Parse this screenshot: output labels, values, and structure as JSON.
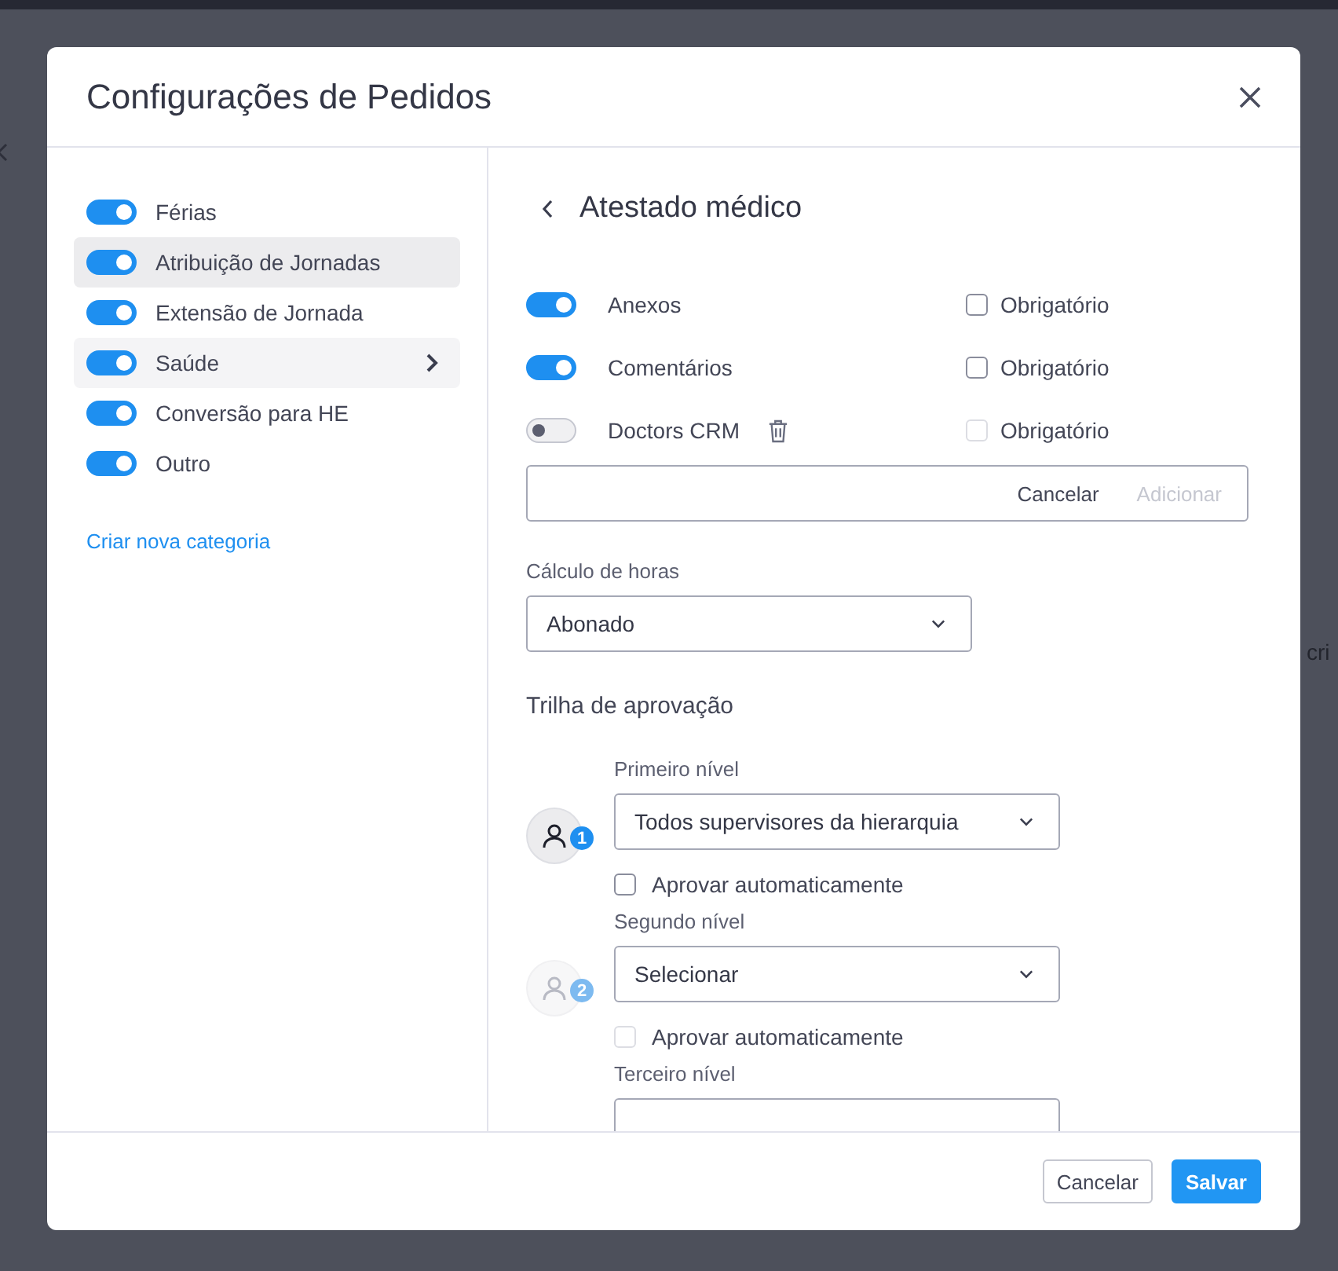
{
  "background": {
    "text": "cri"
  },
  "dialog": {
    "title": "Configurações de Pedidos",
    "categories": [
      {
        "label": "Férias",
        "on": true,
        "selected": false,
        "hovered": false
      },
      {
        "label": "Atribuição de Jornadas",
        "on": true,
        "selected": false,
        "hovered": true
      },
      {
        "label": "Extensão de Jornada",
        "on": true,
        "selected": false,
        "hovered": false
      },
      {
        "label": "Saúde",
        "on": true,
        "selected": true,
        "hovered": false
      },
      {
        "label": "Conversão para HE",
        "on": true,
        "selected": false,
        "hovered": false
      },
      {
        "label": "Outro",
        "on": true,
        "selected": false,
        "hovered": false
      }
    ],
    "new_category_link": "Criar nova categoria",
    "detail": {
      "title": "Atestado médico",
      "fields": [
        {
          "label": "Anexos",
          "on": true,
          "deletable": false,
          "required": {
            "label": "Obrigatório",
            "checked": false,
            "disabled": false
          }
        },
        {
          "label": "Comentários",
          "on": true,
          "deletable": false,
          "required": {
            "label": "Obrigatório",
            "checked": false,
            "disabled": false
          }
        },
        {
          "label": "Doctors CRM",
          "on": false,
          "deletable": true,
          "required": {
            "label": "Obrigatório",
            "checked": false,
            "disabled": true
          }
        }
      ],
      "new_field": {
        "cancel": "Cancelar",
        "add": "Adicionar",
        "add_disabled": true
      },
      "hours": {
        "label": "Cálculo de horas",
        "value": "Abonado"
      },
      "approval": {
        "title": "Trilha de aprovação",
        "levels": [
          {
            "label": "Primeiro nível",
            "number": "1",
            "active": true,
            "value": "Todos supervisores da hierarquia",
            "auto_approve": {
              "label": "Aprovar automaticamente",
              "checked": false,
              "disabled": false
            }
          },
          {
            "label": "Segundo nível",
            "number": "2",
            "active": false,
            "value": "Selecionar",
            "auto_approve": {
              "label": "Aprovar automaticamente",
              "checked": false,
              "disabled": true
            }
          },
          {
            "label": "Terceiro nível"
          }
        ]
      }
    },
    "footer": {
      "cancel": "Cancelar",
      "save": "Salvar"
    }
  }
}
